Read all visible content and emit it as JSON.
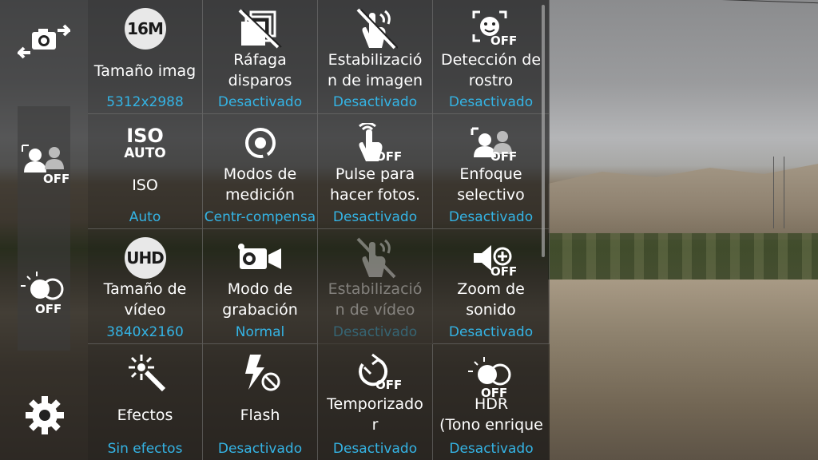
{
  "left_bar": {
    "switch_camera_icon": "camera-switch-icon",
    "selective_focus_off": "OFF",
    "hdr_off": "OFF",
    "settings_icon": "gear-icon"
  },
  "menu": {
    "cells": [
      {
        "label": "Tamaño imag",
        "value": "5312x2988",
        "icon": "16M"
      },
      {
        "label": "Ráfaga\ndisparos",
        "value": "Desactivado",
        "icon": "burst-off-icon"
      },
      {
        "label": "Estabilizació\nn de imagen",
        "value": "Desactivado",
        "icon": "stabilize-off-icon"
      },
      {
        "label": "Detección de\nrostro",
        "value": "Desactivado",
        "icon": "face-detect-off-icon",
        "off": "OFF"
      },
      {
        "label": "ISO",
        "value": "Auto",
        "icon_top": "ISO",
        "icon_bottom": "AUTO"
      },
      {
        "label": "Modos de\nmedición",
        "value": "Centr-compensa",
        "icon": "metering-icon"
      },
      {
        "label": "Pulse para\nhacer fotos.",
        "value": "Desactivado",
        "icon": "tap-shot-off-icon",
        "off": "OFF"
      },
      {
        "label": "Enfoque\nselectivo",
        "value": "Desactivado",
        "icon": "selective-focus-off-icon",
        "off": "OFF"
      },
      {
        "label": "Tamaño de\nvídeo",
        "value": "3840x2160",
        "icon": "UHD"
      },
      {
        "label": "Modo de\ngrabación",
        "value": "Normal",
        "icon": "video-mode-icon"
      },
      {
        "label": "Estabilizació\nn de vídeo",
        "value": "Desactivado",
        "icon": "video-stabilize-off-icon"
      },
      {
        "label": "Zoom de\nsonido",
        "value": "Desactivado",
        "icon": "audio-zoom-off-icon",
        "off": "OFF"
      },
      {
        "label": "Efectos",
        "value": "Sin efectos",
        "icon": "effects-icon"
      },
      {
        "label": "Flash",
        "value": "Desactivado",
        "icon": "flash-off-icon"
      },
      {
        "label": "Temporizado\nr",
        "value": "Desactivado",
        "icon": "timer-off-icon",
        "off": "OFF"
      },
      {
        "label": "HDR\n(Tono enrique",
        "value": "Desactivado",
        "icon": "hdr-off-icon",
        "off": "OFF"
      }
    ]
  }
}
